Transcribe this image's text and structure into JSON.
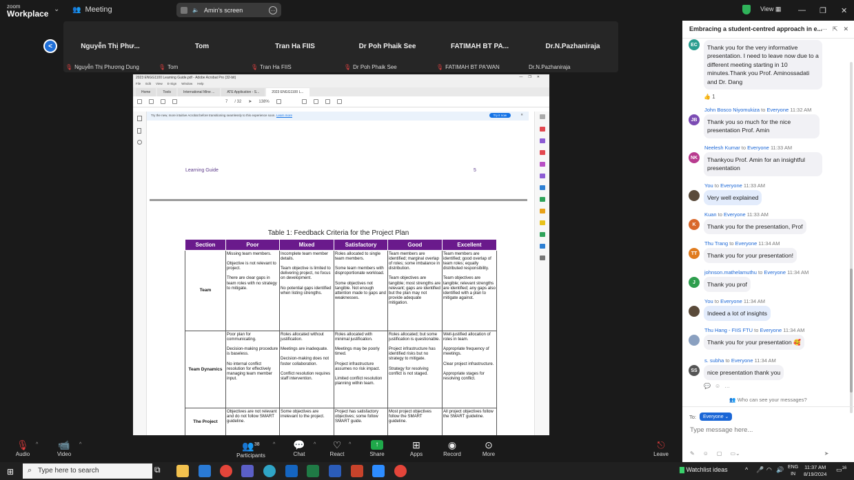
{
  "app": {
    "logo_line1": "zoom",
    "logo_line2": "Workplace",
    "meeting_label": "Meeting",
    "share_label": "Amin's screen",
    "view_label": "View",
    "brand_color": "#1f6fd8"
  },
  "gallery": {
    "tiles": [
      {
        "name": "Nguyễn Thị Phư...",
        "sub": "Nguyễn Thị Phương Dung"
      },
      {
        "name": "Tom",
        "sub": "Tom"
      },
      {
        "name": "Tran Ha FIIS",
        "sub": "Tran Ha FIIS"
      },
      {
        "name": "Dr Poh Phaik See",
        "sub": "Dr Poh Phaik See"
      },
      {
        "name": "FATIMAH BT PA...",
        "sub": "FATIMAH BT PA'WAN"
      },
      {
        "name": "Dr.N.Pazhaniraja",
        "sub": "Dr.N.Pazhaniraja"
      }
    ]
  },
  "acrobat": {
    "window_title": "2023 ENGG1100 Learning Guide.pdf - Adobe Acrobat Pro (32-bit)",
    "menu": [
      "File",
      "Edit",
      "View",
      "E-Sign",
      "Window",
      "Help"
    ],
    "tabs": [
      "Home",
      "Tools",
      "International Mine ...",
      "ATE Application - S...",
      "2023 ENGG1100 L..."
    ],
    "page_num": "7",
    "page_total": "/ 32",
    "zoom": "138%",
    "banner_text": "Try the new, more intuitive Acrobat before transitioning seamlessly to this experience soon.",
    "banner_link": "Learn more",
    "banner_button": "Try it now",
    "doc_header_left": "Learning Guide",
    "doc_header_right": "5",
    "table_caption": "Table 1: Feedback Criteria for the Project Plan",
    "table_header_color": "#6a1a8c",
    "table": {
      "headers": [
        "Section",
        "Poor",
        "Mixed",
        "Satisfactory",
        "Good",
        "Excellent"
      ],
      "rows": [
        {
          "section": "Team",
          "cells": [
            "Missing team members.\n\nObjective is not relevant to project.\n\nThere are clear gaps in team roles with no strategy to mitigate.",
            "Incomplete team member details.\n\nTeam objective is limited to delivering project, no focus on development.\n\nNo potential gaps identified when listing strengths.",
            "Roles allocated to single team members.\n\nSome team members with disproportionate workload.\n\nSome objectives not tangible. Not enough attention made to gaps and weaknesses.",
            "Team members are identified; marginal overlap of roles; some imbalance in distribution.\n\nTeam objectives are tangible; most strengths are relevant; gaps are identified but the plan may not provide adequate mitigation.",
            "Team members are identified; good overlap of team roles; equally distributed responsibility.\n\nTeam objectives are tangible; relevant strengths are identified; any gaps also identified with a plan to mitigate against."
          ]
        },
        {
          "section": "Team Dynamics",
          "cells": [
            "Poor plan for communicating.\n\nDecision-making procedure is baseless.\n\nNo internal conflict resolution for effectively managing team member input.",
            "Roles allocated without justification.\n\nMeetings are inadequate.\n\nDecision-making does not foster collaboration.\n\nConflict resolution requires staff intervention.",
            "Roles allocated with minimal justification.\n\nMeetings may be poorly timed.\n\nProject infrastructure assumes no risk impact.\n\nLimited conflict resolution planning within team.",
            "Roles allocated; but some justification is questionable.\n\nProject infrastructure has identified risks but no strategy to mitigate.\n\nStrategy for resolving conflict is not staged.",
            "Well-justified allocation of roles in team.\n\nAppropriate frequency of meetings.\n\nClear project infrastructure.\n\nAppropriate stages for resolving conflict."
          ]
        },
        {
          "section": "The Project",
          "cells": [
            "Objectives are not relevant and do not follow SMART guideline.",
            "Some objectives are irrelevant to the project.",
            "Project has satisfactory objectives; some follow SMART guide.",
            "Most project objectives follow the SMART guideline.",
            "All project objectives follow the SMART guideline."
          ]
        }
      ]
    }
  },
  "chat": {
    "title": "Embracing a student-centred approach in e...",
    "messages": [
      {
        "initials": "EC",
        "color": "#2a9d8f",
        "meta_sender": "",
        "meta_to": "",
        "meta_time": "",
        "text": "Thank you for the very informative presentation. I need to leave now due to a different meeting starting in 10 minutes.Thank you Prof. Aminossadati and Dr. Dang",
        "mine": false,
        "reaction": "👍 1"
      },
      {
        "initials": "JB",
        "color": "#7b4bb3",
        "meta_sender": "John Bosco Niyomukiza",
        "meta_to": "Everyone",
        "meta_time": "11:32 AM",
        "text": "Thank you so much for the nice presentation Prof. Amin",
        "mine": false
      },
      {
        "initials": "NK",
        "color": "#b83b8f",
        "meta_sender": "Neelesh Kumar",
        "meta_to": "Everyone",
        "meta_time": "11:33 AM",
        "text": "Thankyou Prof. Amin for an insightful presentation",
        "mine": false
      },
      {
        "initials": "",
        "color": "#5a4a3a",
        "meta_sender": "You",
        "meta_to": "Everyone",
        "meta_time": "11:33 AM",
        "text": "Very well explained",
        "mine": true
      },
      {
        "initials": "K",
        "color": "#d9682b",
        "meta_sender": "Kuan",
        "meta_to": "Everyone",
        "meta_time": "11:33 AM",
        "text": "Thank you for the presentation, Prof",
        "mine": false
      },
      {
        "initials": "TT",
        "color": "#e07b1e",
        "meta_sender": "Thu Trang",
        "meta_to": "Everyone",
        "meta_time": "11:34 AM",
        "text": "Thank you for your  presentation!",
        "mine": false
      },
      {
        "initials": "J",
        "color": "#2e9e4e",
        "meta_sender": "johnson.mathelamuthu",
        "meta_to": "Everyone",
        "meta_time": "11:34 AM",
        "text": "Thank you prof",
        "mine": false
      },
      {
        "initials": "",
        "color": "#5a4a3a",
        "meta_sender": "You",
        "meta_to": "Everyone",
        "meta_time": "11:34 AM",
        "text": "Indeed a lot of insights",
        "mine": true
      },
      {
        "initials": "",
        "color": "#8aa0c0",
        "meta_sender": "Thu Hang - FIIS FTU",
        "meta_to": "Everyone",
        "meta_time": "11:34 AM",
        "text": "Thank you for your presentation 🥰",
        "mine": false
      },
      {
        "initials": "SS",
        "color": "#555555",
        "meta_sender": "s. subha",
        "meta_to": "Everyone",
        "meta_time": "11:34 AM",
        "text": "nice presentation thank you",
        "mine": false
      }
    ],
    "to_word": "to",
    "who_can_see": "Who can see your messages?",
    "to_label": "To:",
    "to_value": "Everyone",
    "input_placeholder": "Type message here..."
  },
  "controls": {
    "audio": "Audio",
    "video": "Video",
    "participants": "Participants",
    "participants_count": "38",
    "chat": "Chat",
    "react": "React",
    "share": "Share",
    "apps": "Apps",
    "record": "Record",
    "more": "More",
    "leave": "Leave"
  },
  "taskbar": {
    "search_placeholder": "Type here to search",
    "watchlist": "Watchlist ideas",
    "lang1": "ENG",
    "lang2": "IN",
    "time": "11:37 AM",
    "date": "8/19/2024",
    "notif": "16"
  }
}
